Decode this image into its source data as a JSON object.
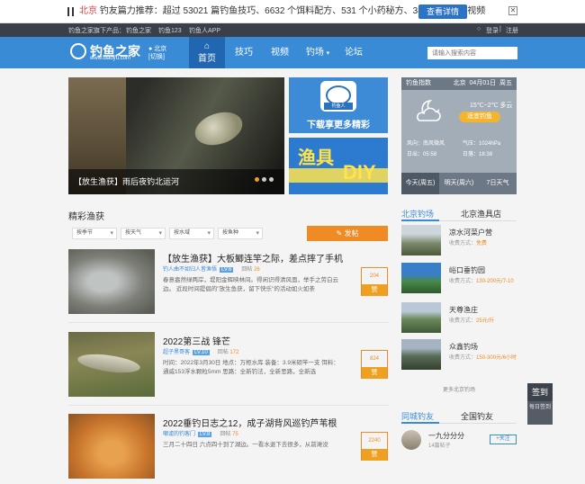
{
  "topbar": {
    "city": "北京",
    "promo_text": "钓友篇力推荐：超过 53021 篇钓鱼技巧、6632 个饵料配方、531 个小药秘方、38106 个钓鱼视频",
    "view_button": "查看详情"
  },
  "subbar": {
    "products": "钓鱼之家旗下产品：",
    "links": [
      "钓鱼之家",
      "钓鱼123",
      "钓鱼人APP"
    ],
    "login": "登录",
    "register": "注册"
  },
  "nav": {
    "logo_name": "钓鱼之家",
    "logo_domain": "www.diaoyu.com",
    "location_city": "北京",
    "location_switch": "[切换]",
    "items": [
      "首页",
      "技巧",
      "视频",
      "钓场",
      "论坛"
    ],
    "search_placeholder": "请输入搜索内容"
  },
  "banner": {
    "caption": "【放生渔获】雨后夜钓北运河",
    "dots": 3,
    "active_dot": 0
  },
  "ads": {
    "app_tag": "钓鱼人",
    "app_text": "下载享更多精彩",
    "gear_line1": "渔具",
    "gear_line2": "DIY"
  },
  "weather": {
    "title": "钓鱼指数",
    "city": "北京",
    "date": "04月01日",
    "weekday": "周五",
    "temp": "15℃~2℃ 多云",
    "level": "适宜钓鱼",
    "wind_label": "风向：",
    "wind": "南风微风",
    "pressure_label": "气压：",
    "pressure": "1024hPa",
    "sunrise_label": "日出：",
    "sunrise": "05:58",
    "sunset_label": "日落：",
    "sunset": "18:38",
    "tabs": [
      "今天(周五)",
      "明天(周六)",
      "7日天气"
    ]
  },
  "section": {
    "title": "精彩渔获",
    "filters": [
      "按季节",
      "按天气",
      "按水域",
      "按鱼种"
    ],
    "post_button": "发帖"
  },
  "feed": [
    {
      "title": "【放生渔获】大板鲫连竿之际，差点摔了手机",
      "author": "钓人曲不如归人皆渔悟",
      "level": "LV.6",
      "reply_label": "回帖",
      "replies": "26",
      "excerpt": "春意盎然绿两岸，堤阳金辉映林间。得闲识得清风面，举手之劳白云边。 近段时间提倡的\"放生鱼获，留下快乐\"的活动如火如荼",
      "likes": "204",
      "like_label": "赞"
    },
    {
      "title": "2022第三战 锋芒",
      "author": "超子黑哥客",
      "level": "LV.10",
      "reply_label": "回帖",
      "replies": "172",
      "excerpt": "时间：2022年3月30日 地点：万柜水库 装备：3.9米硕竿一支 饵料：通威153浮水颗粒5mm 思路：全新钓法，全新思路，全新选",
      "likes": "824",
      "like_label": "赞"
    },
    {
      "title": "2022垂钓日志之12，成子湖背风巡钓芦苇根",
      "author": "嘲谑的钓客门",
      "level": "LV.8",
      "reply_label": "回帖",
      "replies": "75",
      "excerpt": "三月二十四日 六点四十到了湖边。一看水退下去很多，从前滩没",
      "likes": "2240",
      "like_label": "赞"
    }
  ],
  "spots": {
    "tabs": [
      "北京钓场",
      "北京渔具店"
    ],
    "items": [
      {
        "name": "凉水河菜户营",
        "price_label": "收费方式：",
        "price": "免费"
      },
      {
        "name": "峪口垂钓园",
        "price_label": "收费方式：",
        "price": "130-200元/7-10"
      },
      {
        "name": "天尊渔庄",
        "price_label": "收费方式：",
        "price": "25元/斤"
      },
      {
        "name": "众鑫钓场",
        "price_label": "收费方式：",
        "price": "150-300元/6小时"
      }
    ],
    "more": "更多北京钓场"
  },
  "friends": {
    "tabs": [
      "同城钓友",
      "全国钓友"
    ],
    "name": "一九分分分",
    "fans": "14篇帖子",
    "follow": "+关注"
  },
  "sign": {
    "label": "签到",
    "sub": "每日签到"
  }
}
